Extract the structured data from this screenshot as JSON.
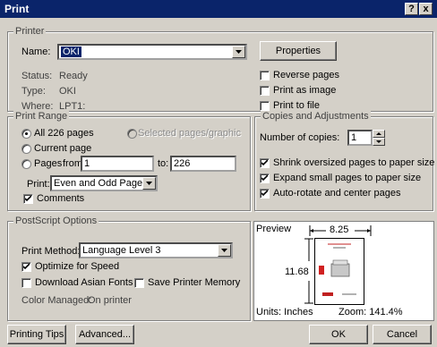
{
  "window": {
    "title": "Print",
    "help_label": "?",
    "close_label": "x"
  },
  "printer": {
    "legend": "Printer",
    "name_label": "Name:",
    "name_value": "OKI",
    "properties_label": "Properties",
    "status_label": "Status:",
    "status_value": "Ready",
    "type_label": "Type:",
    "type_value": "OKI",
    "where_label": "Where:",
    "where_value": "LPT1:",
    "reverse_pages": {
      "label": "Reverse pages",
      "checked": false
    },
    "print_as_image": {
      "label": "Print as image",
      "checked": false
    },
    "print_to_file": {
      "label": "Print to file",
      "checked": false
    }
  },
  "print_range": {
    "legend": "Print Range",
    "all_pages_label": "All 226 pages",
    "selected_label": "Selected pages/graphic",
    "current_page_label": "Current page",
    "pages_label": "Pages",
    "from_label": "from:",
    "from_value": "1",
    "to_label": "to:",
    "to_value": "226",
    "print_label": "Print:",
    "print_value": "Even and Odd Pages",
    "comments": {
      "label": "Comments",
      "checked": true
    }
  },
  "copies": {
    "legend": "Copies and Adjustments",
    "copies_label": "Number of copies:",
    "copies_value": "1",
    "shrink": {
      "label": "Shrink oversized pages to paper size",
      "checked": true
    },
    "expand": {
      "label": "Expand small pages to paper size",
      "checked": true
    },
    "autorotate": {
      "label": "Auto-rotate and center pages",
      "checked": true
    }
  },
  "postscript": {
    "legend": "PostScript Options",
    "method_label": "Print Method:",
    "method_value": "Language Level 3",
    "optimize": {
      "label": "Optimize for Speed",
      "checked": true
    },
    "download_fonts": {
      "label": "Download Asian Fonts",
      "checked": false
    },
    "save_memory": {
      "label": "Save Printer Memory",
      "checked": false
    },
    "color_label": "Color Managed:",
    "color_value": "On printer"
  },
  "preview": {
    "label": "Preview",
    "width_label": "8.25",
    "height_label": "11.68",
    "units_label": "Units: Inches",
    "zoom_label": "Zoom: 141.4%"
  },
  "buttons": {
    "tips": "Printing Tips",
    "advanced": "Advanced...",
    "ok": "OK",
    "cancel": "Cancel"
  }
}
